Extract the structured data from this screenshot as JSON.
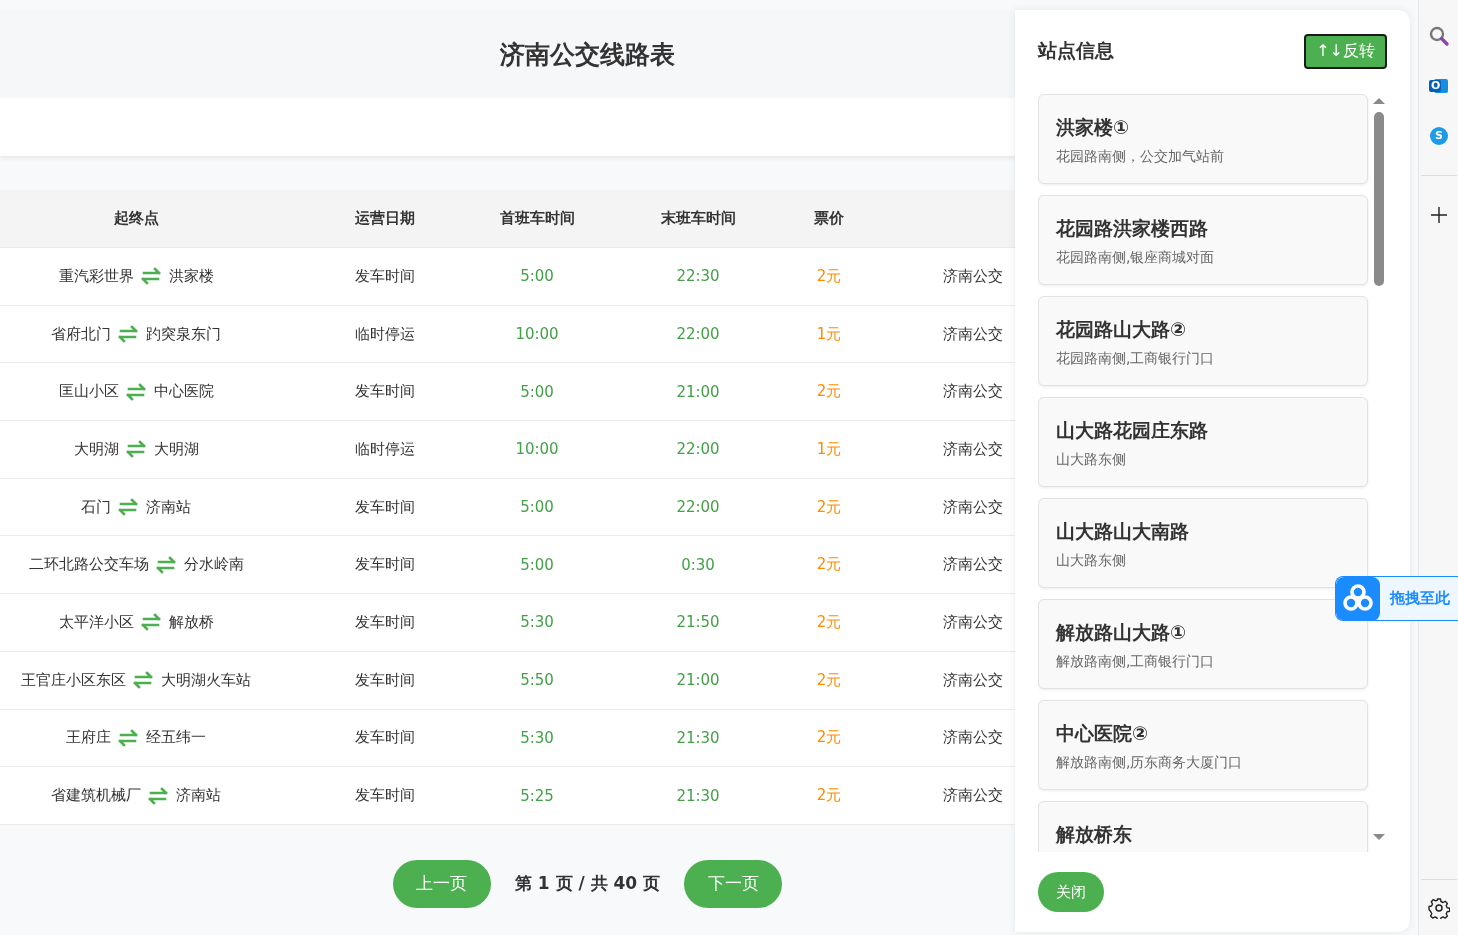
{
  "page": {
    "title": "济南公交线路表"
  },
  "table": {
    "columns": [
      "起终点",
      "运营日期",
      "首班车时间",
      "末班车时间",
      "票价"
    ],
    "rows": [
      {
        "from": "重汽彩世界",
        "to": "洪家楼",
        "operation": "发车时间",
        "first_bus": "5:00",
        "last_bus": "22:30",
        "price": "2元",
        "column_6": "济南公交"
      },
      {
        "from": "省府北门",
        "to": "趵突泉东门",
        "operation": "临时停运",
        "first_bus": "10:00",
        "last_bus": "22:00",
        "price": "1元",
        "column_6": "济南公交"
      },
      {
        "from": "匡山小区",
        "to": "中心医院",
        "operation": "发车时间",
        "first_bus": "5:00",
        "last_bus": "21:00",
        "price": "2元",
        "column_6": "济南公交"
      },
      {
        "from": "大明湖",
        "to": "大明湖",
        "operation": "临时停运",
        "first_bus": "10:00",
        "last_bus": "22:00",
        "price": "1元",
        "column_6": "济南公交"
      },
      {
        "from": "石门",
        "to": "济南站",
        "operation": "发车时间",
        "first_bus": "5:00",
        "last_bus": "22:00",
        "price": "2元",
        "column_6": "济南公交"
      },
      {
        "from": "二环北路公交车场",
        "to": "分水岭南",
        "operation": "发车时间",
        "first_bus": "5:00",
        "last_bus": "0:30",
        "price": "2元",
        "column_6": "济南公交"
      },
      {
        "from": "太平洋小区",
        "to": "解放桥",
        "operation": "发车时间",
        "first_bus": "5:30",
        "last_bus": "21:50",
        "price": "2元",
        "column_6": "济南公交"
      },
      {
        "from": "王官庄小区东区",
        "to": "大明湖火车站",
        "operation": "发车时间",
        "first_bus": "5:50",
        "last_bus": "21:00",
        "price": "2元",
        "column_6": "济南公交"
      },
      {
        "from": "王府庄",
        "to": "经五纬一",
        "operation": "发车时间",
        "first_bus": "5:30",
        "last_bus": "21:30",
        "price": "2元",
        "column_6": "济南公交"
      },
      {
        "from": "省建筑机械厂",
        "to": "济南站",
        "operation": "发车时间",
        "first_bus": "5:25",
        "last_bus": "21:30",
        "price": "2元",
        "column_6": "济南公交"
      }
    ]
  },
  "pagination": {
    "prev": "上一页",
    "info": "第 1 页 / 共 40 页",
    "next": "下一页"
  },
  "station_panel": {
    "title": "站点信息",
    "reverse_button": "↑↓反转",
    "close_button": "关闭",
    "stations": [
      {
        "name": "洪家楼①",
        "address": "花园路南侧，公交加气站前"
      },
      {
        "name": "花园路洪家楼西路",
        "address": "花园路南侧,银座商城对面"
      },
      {
        "name": "花园路山大路②",
        "address": "花园路南侧,工商银行门口"
      },
      {
        "name": "山大路花园庄东路",
        "address": "山大路东侧"
      },
      {
        "name": "山大路山大南路",
        "address": "山大路东侧"
      },
      {
        "name": "解放路山大路①",
        "address": "解放路南侧,工商银行门口"
      },
      {
        "name": "中心医院②",
        "address": "解放路南侧,历东商务大厦门口"
      },
      {
        "name": "解放桥东"
      }
    ]
  },
  "drag_float": {
    "label": "拖拽至此"
  },
  "side_bar": {
    "apps": [
      {
        "kind": "search"
      },
      {
        "kind": "mail",
        "glyph": "O"
      },
      {
        "kind": "chat",
        "glyph": "S"
      },
      {
        "kind": "add"
      }
    ],
    "bottom": [
      {
        "kind": "settings"
      }
    ]
  }
}
